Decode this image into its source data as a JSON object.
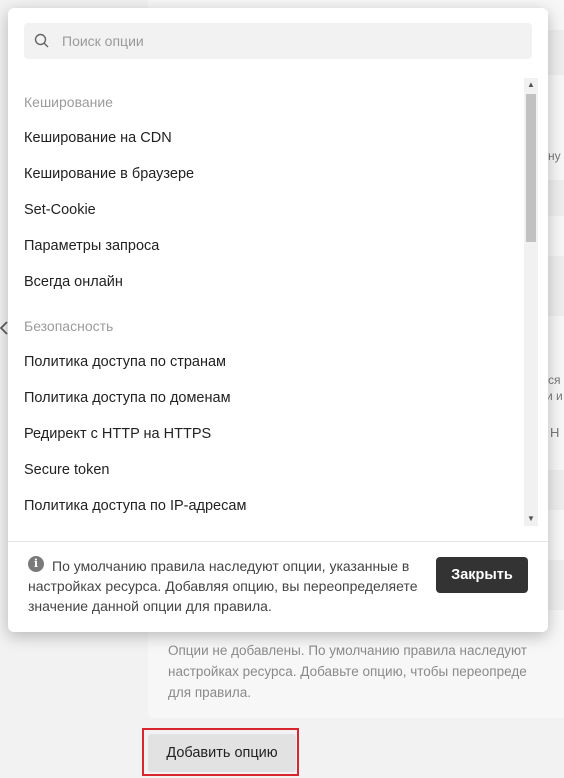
{
  "search": {
    "placeholder": "Поиск опции"
  },
  "groups": [
    {
      "title": "Кеширование",
      "items": [
        "Кеширование на CDN",
        "Кеширование в браузере",
        "Set-Cookie",
        "Параметры запроса",
        "Всегда онлайн"
      ]
    },
    {
      "title": "Безопасность",
      "items": [
        "Политика доступа по странам",
        "Политика доступа по доменам",
        "Редирект с HTTP на HTTPS",
        "Secure token",
        "Политика доступа по IP-адресам"
      ]
    }
  ],
  "footer": {
    "info": "По умолчанию правила наследуют опции, указанные в настройках ресурса. Добавляя опцию, вы переопределяете значение данной опции для правила.",
    "close_label": "Закрыть"
  },
  "background": {
    "fragments": [
      "ну",
      "ся",
      "и и",
      "Н"
    ],
    "hint": "Опции не добавлены. По умолчанию правила наследуют\nнастройках ресурса. Добавьте опцию, чтобы переопреде\nдля правила.",
    "add_option_label": "Добавить опцию"
  },
  "icons": {
    "search": "search-icon",
    "info": "info-icon",
    "chevron": "chevron-left-icon"
  }
}
